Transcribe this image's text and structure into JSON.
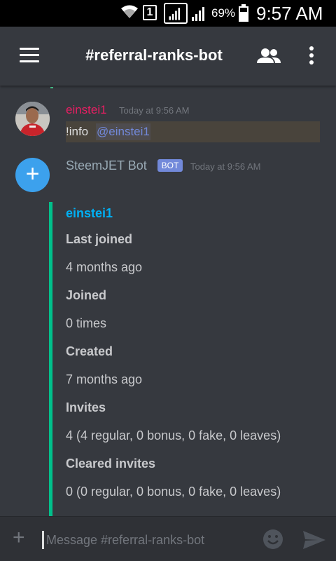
{
  "status_bar": {
    "sim_slot": "1",
    "battery_percent": "69%",
    "time": "9:57 AM"
  },
  "header": {
    "channel_title": "#referral-ranks-bot"
  },
  "messages": [
    {
      "author": "einstei1",
      "timestamp": "Today at 9:56 AM",
      "command": "!info",
      "mention": "@einstei1"
    },
    {
      "author": "SteemJET Bot",
      "badge": "BOT",
      "timestamp": "Today at 9:56 AM",
      "embed": {
        "title": "einstei1",
        "fields": [
          {
            "name": "Last joined",
            "value": "4 months ago"
          },
          {
            "name": "Joined",
            "value": "0 times"
          },
          {
            "name": "Created",
            "value": "7 months ago"
          },
          {
            "name": "Invites",
            "value": "4 (4 regular, 0 bonus, 0 fake, 0 leaves)"
          },
          {
            "name": "Cleared invites",
            "value": "0 (0 regular, 0 bonus, 0 fake, 0 leaves)"
          }
        ]
      }
    }
  ],
  "composer": {
    "placeholder": "Message #referral-ranks-bot"
  },
  "colors": {
    "background": "#36393f",
    "user_name": "#e91e63",
    "mention": "#7289da",
    "embed_accent": "#00c08b",
    "embed_title": "#00b0f4",
    "bot_badge": "#7289da"
  }
}
